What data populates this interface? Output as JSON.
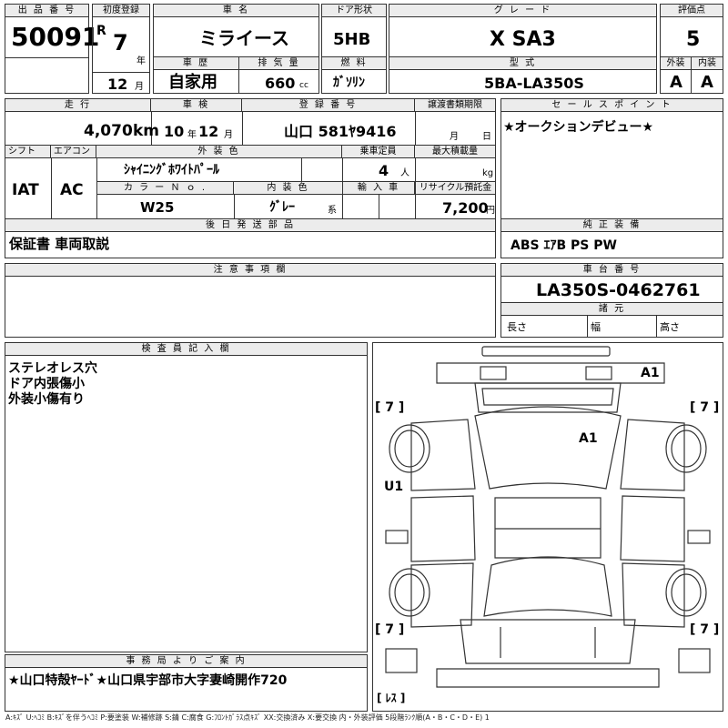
{
  "header": {
    "lot_number_label": "出 品 番 号",
    "lot_number": "50091",
    "first_reg_label": "初度登録",
    "era_mark": "R",
    "year_value": "7",
    "year_unit": "年",
    "month_value": "12",
    "month_unit": "月",
    "car_name_label": "車 名",
    "car_name": "ミライース",
    "door_label": "ドア形状",
    "door": "5HB",
    "grade_label": "グ レ ー ド",
    "grade": "X SA3",
    "score_label": "評価点",
    "score": "5",
    "history_label": "車 歴",
    "history": "自家用",
    "displacement_label": "排 気 量",
    "displacement": "660",
    "displacement_unit": "cc",
    "fuel_label": "燃 料",
    "fuel": "ｶﾞｿﾘﾝ",
    "model_label": "型 式",
    "model": "5BA-LA350S",
    "exterior_label": "外装",
    "exterior_grade": "A",
    "interior_label": "内装",
    "interior_grade": "A"
  },
  "row2": {
    "mileage_label": "走 行",
    "mileage": "4,070",
    "mileage_unit": "km",
    "inspection_label": "車 検",
    "inspection_year": "10",
    "inspection_year_unit": "年",
    "inspection_month": "12",
    "inspection_month_unit": "月",
    "plate_label": "登 録 番 号",
    "plate": "山口 581ﾔ9416",
    "transfer_label": "譲渡書類期限",
    "transfer_month_unit": "月",
    "transfer_day_unit": "日",
    "shift_label": "シフト",
    "shift": "IAT",
    "ac_label": "エアコン",
    "ac": "AC",
    "color_label": "外 装 色",
    "color": "ｼｬｲﾆﾝｸﾞﾎﾜｲﾄﾊﾟｰﾙ",
    "capacity_label": "乗車定員",
    "capacity": "4",
    "capacity_unit": "人",
    "load_label": "最大積載量",
    "load_unit": "kg",
    "color_no_label": "カ ラ ー Ｎ ｏ .",
    "color_no": "W25",
    "interior_color_label": "内 装 色",
    "interior_color": "ｸﾞﾚｰ",
    "interior_color_unit": "系",
    "import_label": "輸 入 車",
    "recycle_label": "リサイクル預託金",
    "recycle": "7,200",
    "recycle_unit": "円"
  },
  "later_parts": {
    "label": "後 日 発 送 部 品",
    "value": "保証書 車両取説"
  },
  "sales_point": {
    "label": "セ ー ル ス ポ イ ン ト",
    "value": "★オークションデビュー★"
  },
  "equipment": {
    "label": "純 正 装 備",
    "value": "ABS ｴｱB PS PW"
  },
  "notes": {
    "label": "注 意 事 項 欄"
  },
  "chassis": {
    "label": "車 台 番 号",
    "value": "LA350S-0462761",
    "spec_label": "諸 元",
    "length_label": "長さ",
    "width_label": "幅",
    "height_label": "高さ"
  },
  "inspector": {
    "label": "検 査 員 記 入 欄",
    "lines": [
      "ステレオレス穴",
      "ドア内張傷小",
      "外装小傷有り"
    ]
  },
  "diagram": {
    "marks": [
      "A1",
      "A1",
      "U1"
    ],
    "tires": [
      "7",
      "7",
      "7",
      "7"
    ],
    "spare": "ﾚｽ"
  },
  "office": {
    "label": "事 務 局 よ り ご 案 内",
    "value": "★山口特殻ﾔｰﾄﾞ★山口県宇部市大字妻崎開作720"
  },
  "legend": "A:ｷｽﾞ U:ﾍｺﾐ B:ｷｽﾞを伴うﾍｺﾐ P:要塗装 W:補修跡 S:錆 C:腐食 G:ﾌﾛﾝﾄｶﾞﾗｽ点ｷｽﾞ XX:交換済み X:要交換 内・外装評価 5段階ﾗﾝｸ順(A・B・C・D・E) 1"
}
